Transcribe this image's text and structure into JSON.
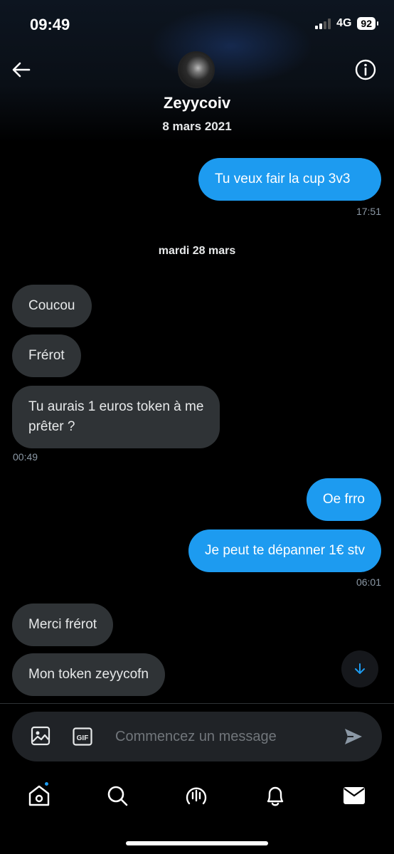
{
  "status_bar": {
    "time": "09:49",
    "network": "4G",
    "battery": "92"
  },
  "header": {
    "contact_name": "Zeyycoiv",
    "joined_date": "8 mars 2021"
  },
  "conversation": {
    "day_separator": "mardi 28 mars",
    "messages": [
      {
        "direction": "out",
        "text": "Tu veux fair la cup 3v3",
        "timestamp": "17:51"
      },
      {
        "direction": "in",
        "text": "Coucou"
      },
      {
        "direction": "in",
        "text": "Frérot"
      },
      {
        "direction": "in",
        "text_line1": "Tu aurais 1 euros token à me",
        "text_line2": "prêter ?",
        "timestamp": "00:49"
      },
      {
        "direction": "out",
        "text": "Oe frro"
      },
      {
        "direction": "out",
        "text": "Je peut te dépanner 1€ stv",
        "timestamp": "06:01"
      },
      {
        "direction": "in",
        "text": "Merci frérot"
      },
      {
        "direction": "in",
        "text": "Mon token zeyycofn"
      }
    ]
  },
  "composer": {
    "placeholder": "Commencez un message",
    "gif_label": "GIF"
  },
  "colors": {
    "accent": "#1d9bf0",
    "incoming_bubble": "#2f3336",
    "background": "#000000"
  },
  "tabbar": {
    "items": [
      "home-icon",
      "search-icon",
      "spaces-icon",
      "notifications-icon",
      "messages-icon"
    ],
    "home_has_badge": true
  }
}
